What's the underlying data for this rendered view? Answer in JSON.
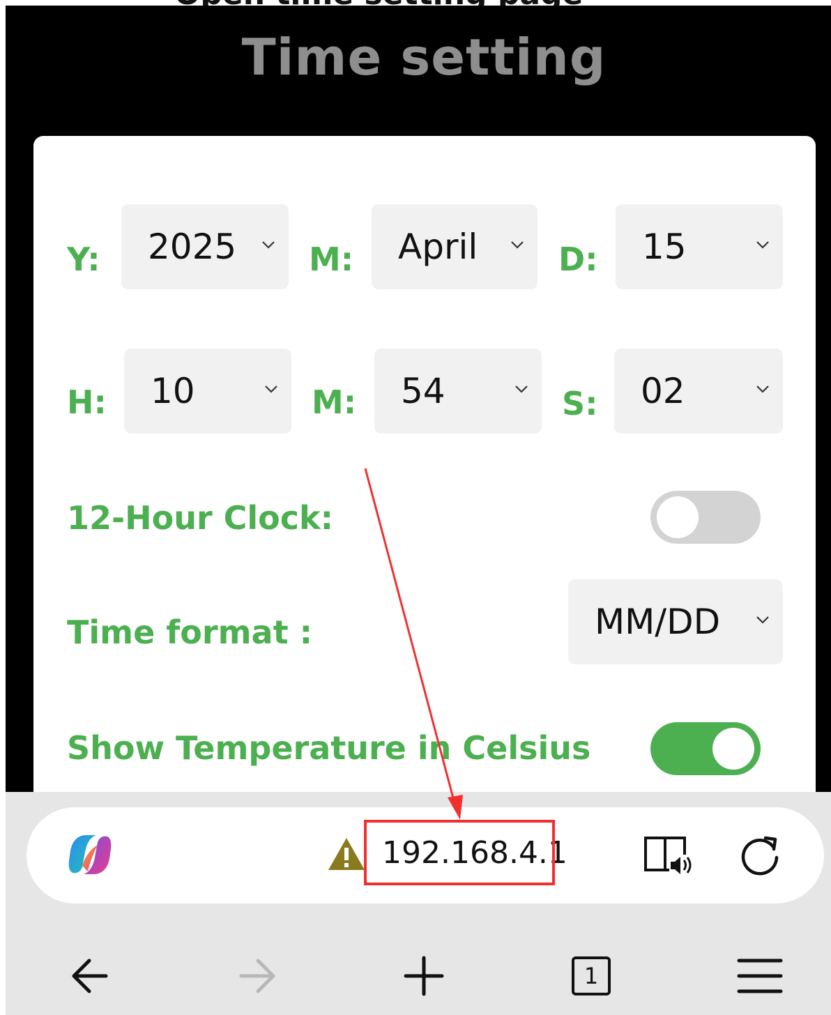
{
  "page": {
    "title": "Time setting",
    "top_caption_fragment": "Open time setting page"
  },
  "date_row": {
    "year_label": "Y:",
    "year_value": "2025",
    "month_label": "M:",
    "month_value": "April",
    "day_label": "D:",
    "day_value": "15"
  },
  "time_row": {
    "hour_label": "H:",
    "hour_value": "10",
    "minute_label": "M:",
    "minute_value": "54",
    "second_label": "S:",
    "second_value": "02"
  },
  "settings": {
    "clock12_label": "12-Hour Clock:",
    "clock12_on": false,
    "format_label": "Time format :",
    "format_value": "MM/DD",
    "celsius_label": "Show Temperature in Celsius",
    "celsius_on": true
  },
  "browser": {
    "url": "192.168.4.1",
    "tab_count": "1",
    "icons": [
      "copilot-icon",
      "warning-icon",
      "read-aloud-icon",
      "reload-icon",
      "back-icon",
      "forward-icon",
      "new-tab-icon",
      "tabs-icon",
      "menu-icon"
    ]
  },
  "colors": {
    "accent": "#4caf50",
    "annotation": "#f03030",
    "title_gray": "#8e8e8e"
  }
}
